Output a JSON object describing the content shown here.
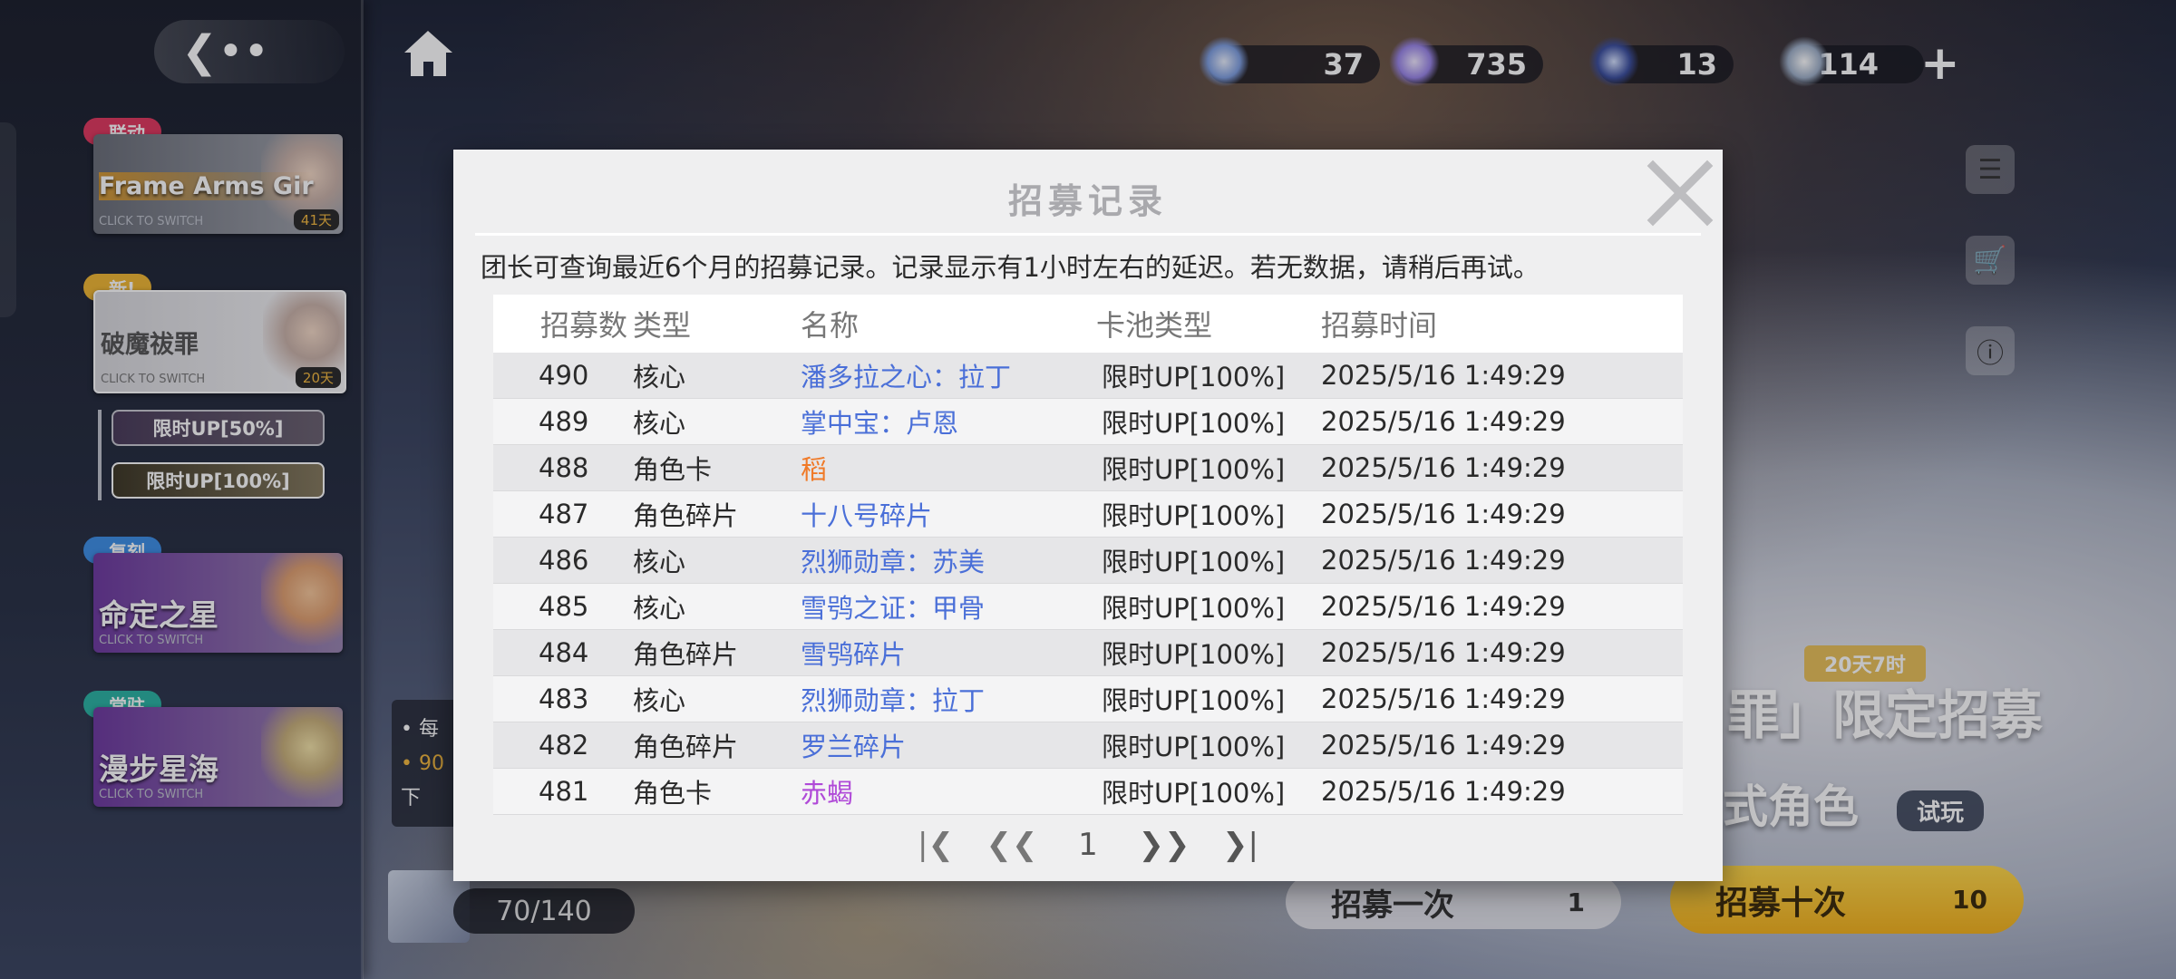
{
  "colors": {
    "name_blue": "#4a6fd8",
    "name_orange": "#f07a28",
    "name_purple": "#b04ad8",
    "tag_pink": "#e0385f",
    "tag_yellow": "#f0b733",
    "tag_blue": "#3e8fe6",
    "tag_teal": "#2bb3a3"
  },
  "topbar": {
    "back_icon": "back-arrow-icon",
    "home_icon": "home-icon",
    "currencies": [
      {
        "icon": "crystal-blue-icon",
        "value": "37"
      },
      {
        "icon": "crystal-purple-icon",
        "value": "735"
      },
      {
        "icon": "ticket-icon",
        "value": "13"
      },
      {
        "icon": "gem-icon",
        "value": "114"
      }
    ],
    "add_icon": "plus-icon"
  },
  "sidebar": {
    "banners": [
      {
        "tag": "联动",
        "title": "Frame Arms Gir",
        "subtitle": "CLICK TO SWITCH",
        "days": "41天"
      },
      {
        "tag": "新!",
        "title": "破魔祓罪",
        "subtitle": "CLICK TO SWITCH",
        "days": "20天"
      },
      {
        "tag": "复刻",
        "title": "命定之星",
        "subtitle": "CLICK TO SWITCH"
      },
      {
        "tag": "常驻",
        "title": "漫步星海",
        "subtitle": "CLICK TO SWITCH"
      }
    ],
    "sub_buttons": [
      "限时UP[50%]",
      "限时UP[100%]"
    ]
  },
  "promo": {
    "title": "罪」限定招募",
    "subtitle": "式角色",
    "timer": "20天7时",
    "trial": "试玩",
    "notice_lines": [
      "• 每",
      "• 90",
      "下"
    ]
  },
  "bottom": {
    "ticket_count": "70/140",
    "recruit_one": "招募一次",
    "recruit_one_cost": "1",
    "recruit_ten": "招募十次",
    "recruit_ten_cost": "10"
  },
  "modal": {
    "title": "招募记录",
    "close_icon": "close-x-icon",
    "description": "团长可查询最近6个月的招募记录。记录显示有1小时左右的延迟。若无数据，请稍后再试。",
    "columns": [
      "招募数",
      "类型",
      "名称",
      "卡池类型",
      "招募时间"
    ],
    "rows": [
      {
        "no": "490",
        "type": "核心",
        "name": "潘多拉之心：拉丁",
        "color": "blue",
        "pool": "限时UP[100%]",
        "time": "2025/5/16 1:49:29"
      },
      {
        "no": "489",
        "type": "核心",
        "name": "掌中宝：卢恩",
        "color": "blue",
        "pool": "限时UP[100%]",
        "time": "2025/5/16 1:49:29"
      },
      {
        "no": "488",
        "type": "角色卡",
        "name": "稻",
        "color": "orange",
        "pool": "限时UP[100%]",
        "time": "2025/5/16 1:49:29"
      },
      {
        "no": "487",
        "type": "角色碎片",
        "name": "十八号碎片",
        "color": "blue",
        "pool": "限时UP[100%]",
        "time": "2025/5/16 1:49:29"
      },
      {
        "no": "486",
        "type": "核心",
        "name": "烈狮勋章：苏美",
        "color": "blue",
        "pool": "限时UP[100%]",
        "time": "2025/5/16 1:49:29"
      },
      {
        "no": "485",
        "type": "核心",
        "name": "雪鸮之证：甲骨",
        "color": "blue",
        "pool": "限时UP[100%]",
        "time": "2025/5/16 1:49:29"
      },
      {
        "no": "484",
        "type": "角色碎片",
        "name": "雪鸮碎片",
        "color": "blue",
        "pool": "限时UP[100%]",
        "time": "2025/5/16 1:49:29"
      },
      {
        "no": "483",
        "type": "核心",
        "name": "烈狮勋章：拉丁",
        "color": "blue",
        "pool": "限时UP[100%]",
        "time": "2025/5/16 1:49:29"
      },
      {
        "no": "482",
        "type": "角色碎片",
        "name": "罗兰碎片",
        "color": "blue",
        "pool": "限时UP[100%]",
        "time": "2025/5/16 1:49:29"
      },
      {
        "no": "481",
        "type": "角色卡",
        "name": "赤蝎",
        "color": "purple",
        "pool": "限时UP[100%]",
        "time": "2025/5/16 1:49:29"
      }
    ],
    "pager": {
      "page": "1"
    }
  }
}
